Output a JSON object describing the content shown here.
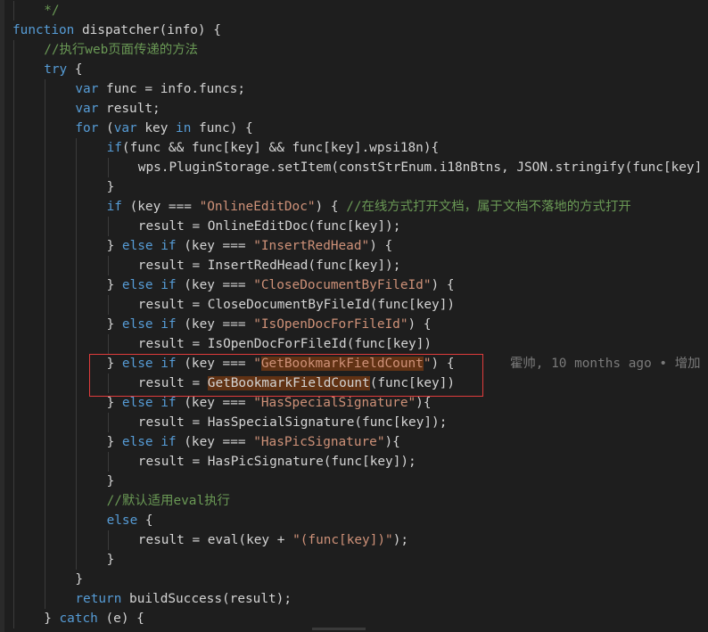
{
  "editor": {
    "blame": "霍帅, 10 months ago • 增加",
    "lines": [
      {
        "indent": 1,
        "tokens": [
          {
            "t": "*/",
            "c": "cm"
          }
        ]
      },
      {
        "indent": 0,
        "tokens": [
          {
            "t": "function",
            "c": "kw"
          },
          {
            "t": " dispatcher(info) {",
            "c": "tx"
          }
        ]
      },
      {
        "indent": 1,
        "tokens": [
          {
            "t": "//执行web页面传递的方法",
            "c": "cm"
          }
        ]
      },
      {
        "indent": 1,
        "tokens": [
          {
            "t": "try",
            "c": "kw"
          },
          {
            "t": " {",
            "c": "tx"
          }
        ]
      },
      {
        "indent": 2,
        "tokens": [
          {
            "t": "var",
            "c": "kw"
          },
          {
            "t": " func = info.funcs;",
            "c": "tx"
          }
        ]
      },
      {
        "indent": 2,
        "tokens": [
          {
            "t": "var",
            "c": "kw"
          },
          {
            "t": " result;",
            "c": "tx"
          }
        ]
      },
      {
        "indent": 2,
        "tokens": [
          {
            "t": "for",
            "c": "kw"
          },
          {
            "t": " (",
            "c": "tx"
          },
          {
            "t": "var",
            "c": "kw"
          },
          {
            "t": " key ",
            "c": "tx"
          },
          {
            "t": "in",
            "c": "kw"
          },
          {
            "t": " func) {",
            "c": "tx"
          }
        ]
      },
      {
        "indent": 3,
        "tokens": [
          {
            "t": "if",
            "c": "kw"
          },
          {
            "t": "(func && func[key] && func[key].wpsi18n){",
            "c": "tx"
          }
        ]
      },
      {
        "indent": 4,
        "tokens": [
          {
            "t": "wps.PluginStorage.setItem(constStrEnum.i18nBtns, JSON.stringify(func[key]",
            "c": "tx"
          }
        ]
      },
      {
        "indent": 3,
        "tokens": [
          {
            "t": "}",
            "c": "tx"
          }
        ]
      },
      {
        "indent": 3,
        "tokens": [
          {
            "t": "if",
            "c": "kw"
          },
          {
            "t": " (key === ",
            "c": "tx"
          },
          {
            "t": "\"OnlineEditDoc\"",
            "c": "str"
          },
          {
            "t": ") { ",
            "c": "tx"
          },
          {
            "t": "//在线方式打开文档，属于文档不落地的方式打开",
            "c": "cm"
          }
        ]
      },
      {
        "indent": 4,
        "tokens": [
          {
            "t": "result = OnlineEditDoc(func[key]);",
            "c": "tx"
          }
        ]
      },
      {
        "indent": 3,
        "tokens": [
          {
            "t": "} ",
            "c": "tx"
          },
          {
            "t": "else if",
            "c": "kw"
          },
          {
            "t": " (key === ",
            "c": "tx"
          },
          {
            "t": "\"InsertRedHead\"",
            "c": "str"
          },
          {
            "t": ") {",
            "c": "tx"
          }
        ]
      },
      {
        "indent": 4,
        "tokens": [
          {
            "t": "result = InsertRedHead(func[key]);",
            "c": "tx"
          }
        ]
      },
      {
        "indent": 3,
        "tokens": [
          {
            "t": "} ",
            "c": "tx"
          },
          {
            "t": "else if",
            "c": "kw"
          },
          {
            "t": " (key === ",
            "c": "tx"
          },
          {
            "t": "\"CloseDocumentByFileId\"",
            "c": "str"
          },
          {
            "t": ") {",
            "c": "tx"
          }
        ]
      },
      {
        "indent": 4,
        "tokens": [
          {
            "t": "result = CloseDocumentByFileId(func[key])",
            "c": "tx"
          }
        ]
      },
      {
        "indent": 3,
        "tokens": [
          {
            "t": "} ",
            "c": "tx"
          },
          {
            "t": "else if",
            "c": "kw"
          },
          {
            "t": " (key === ",
            "c": "tx"
          },
          {
            "t": "\"IsOpenDocForFileId\"",
            "c": "str"
          },
          {
            "t": ") {",
            "c": "tx"
          }
        ]
      },
      {
        "indent": 4,
        "tokens": [
          {
            "t": "result = IsOpenDocForFileId(func[key])",
            "c": "tx"
          }
        ]
      },
      {
        "indent": 3,
        "tokens": [
          {
            "t": "} ",
            "c": "tx"
          },
          {
            "t": "else if",
            "c": "kw"
          },
          {
            "t": " (key === ",
            "c": "tx"
          },
          {
            "t": "\"",
            "c": "str"
          },
          {
            "t": "GetBookmarkFieldCount",
            "c": "hlstr"
          },
          {
            "t": "\"",
            "c": "str"
          },
          {
            "t": ") {",
            "c": "tx"
          }
        ]
      },
      {
        "indent": 4,
        "tokens": [
          {
            "t": "result = ",
            "c": "tx"
          },
          {
            "t": "GetBookmarkFieldCount",
            "c": "hltx"
          },
          {
            "t": "(func[key])",
            "c": "tx"
          }
        ]
      },
      {
        "indent": 3,
        "tokens": [
          {
            "t": "} ",
            "c": "tx"
          },
          {
            "t": "else if",
            "c": "kw"
          },
          {
            "t": " (key === ",
            "c": "tx"
          },
          {
            "t": "\"HasSpecialSignature\"",
            "c": "str"
          },
          {
            "t": "){",
            "c": "tx"
          }
        ]
      },
      {
        "indent": 4,
        "tokens": [
          {
            "t": "result = HasSpecialSignature(func[key]);",
            "c": "tx"
          }
        ]
      },
      {
        "indent": 3,
        "tokens": [
          {
            "t": "} ",
            "c": "tx"
          },
          {
            "t": "else if",
            "c": "kw"
          },
          {
            "t": " (key === ",
            "c": "tx"
          },
          {
            "t": "\"HasPicSignature\"",
            "c": "str"
          },
          {
            "t": "){",
            "c": "tx"
          }
        ]
      },
      {
        "indent": 4,
        "tokens": [
          {
            "t": "result = HasPicSignature(func[key]);",
            "c": "tx"
          }
        ]
      },
      {
        "indent": 3,
        "tokens": [
          {
            "t": "}",
            "c": "tx"
          }
        ]
      },
      {
        "indent": 3,
        "tokens": [
          {
            "t": "//默认适用eval执行",
            "c": "cm"
          }
        ]
      },
      {
        "indent": 3,
        "tokens": [
          {
            "t": "else",
            "c": "kw"
          },
          {
            "t": " {",
            "c": "tx"
          }
        ]
      },
      {
        "indent": 4,
        "tokens": [
          {
            "t": "result = eval(key + ",
            "c": "tx"
          },
          {
            "t": "\"(func[key])\"",
            "c": "str"
          },
          {
            "t": ");",
            "c": "tx"
          }
        ]
      },
      {
        "indent": 3,
        "tokens": [
          {
            "t": "}",
            "c": "tx"
          }
        ]
      },
      {
        "indent": 2,
        "tokens": [
          {
            "t": "}",
            "c": "tx"
          }
        ]
      },
      {
        "indent": 2,
        "tokens": [
          {
            "t": "return",
            "c": "kw"
          },
          {
            "t": " buildSuccess(result);",
            "c": "tx"
          }
        ]
      },
      {
        "indent": 1,
        "tokens": [
          {
            "t": "} ",
            "c": "tx"
          },
          {
            "t": "catch",
            "c": "kw"
          },
          {
            "t": " (e) {",
            "c": "tx"
          }
        ]
      }
    ]
  }
}
